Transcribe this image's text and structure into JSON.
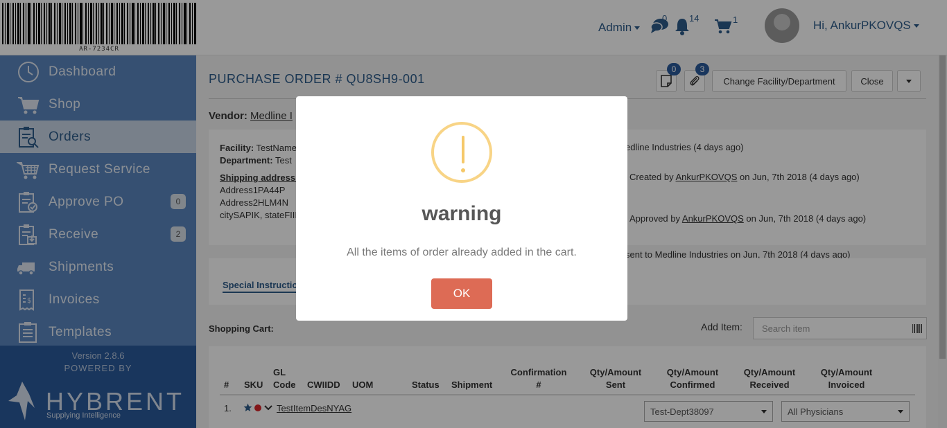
{
  "header": {
    "barcode_text": "AR-7234CR",
    "admin_label": "Admin",
    "messages_count": "0",
    "notifications_count": "14",
    "cart_count": "1",
    "greeting": "Hi, AnkurPKOVQS"
  },
  "sidebar": {
    "items": [
      {
        "label": "Dashboard",
        "icon": "clock-icon"
      },
      {
        "label": "Shop",
        "icon": "cart-icon"
      },
      {
        "label": "Orders",
        "icon": "orders-clipboard-icon"
      },
      {
        "label": "Request Service",
        "icon": "service-cart-icon"
      },
      {
        "label": "Approve PO",
        "icon": "approve-clipboard-icon",
        "badge": "0"
      },
      {
        "label": "Receive",
        "icon": "receive-clipboard-icon",
        "badge": "2"
      },
      {
        "label": "Shipments",
        "icon": "truck-icon"
      },
      {
        "label": "Invoices",
        "icon": "invoice-icon"
      },
      {
        "label": "Templates",
        "icon": "template-clipboard-icon"
      }
    ],
    "version": "Version 2.8.6",
    "powered_by": "POWERED BY",
    "logo_text": "HYBRENT",
    "logo_tagline": "Supplying Intelligence"
  },
  "main": {
    "title": "PURCHASE ORDER # QU8SH9-001",
    "notes_badge": "0",
    "attachments_badge": "3",
    "change_facility_label": "Change Facility/Department",
    "close_label": "Close",
    "vendor_label": "Vendor:",
    "vendor_name": "Medline I",
    "facility_label": "Facility:",
    "facility_value": "TestName",
    "department_label": "Department:",
    "department_value": "Test",
    "shipping_label": "Shipping address:",
    "address1": "Address1PA44P",
    "address2": "Address2HLM4N",
    "address3": "citySAPIK, stateFIII",
    "history": {
      "vendor_line": "edline Industries (4 days ago)",
      "created_prefix": "Created by",
      "created_user": "AnkurPKOVQS",
      "created_suffix": "on Jun, 7th 2018 (4 days ago)",
      "approved_prefix": "Approved by",
      "approved_user": "AnkurPKOVQS",
      "approved_suffix": "on Jun, 7th 2018 (4 days ago)",
      "sent_prefix": "sent to",
      "sent_vendor": "Medline Industries",
      "sent_suffix": "on Jun, 7th 2018 (4 days ago)"
    },
    "tab_label": "Special Instructio",
    "cart_label": "Shopping Cart:",
    "add_item_label": "Add Item:",
    "search_placeholder": "Search item",
    "table": {
      "headers": [
        "#",
        "SKU",
        "GL\nCode",
        "CWIIDD",
        "UOM",
        "Status",
        "Shipment",
        "Confirmation\n#",
        "Qty/Amount\nSent",
        "Qty/Amount\nConfirmed",
        "Qty/Amount\nReceived",
        "Qty/Amount\nInvoiced"
      ],
      "rows": [
        {
          "num": "1.",
          "item": "TestItemDesNYAG",
          "department": "Test-Dept38097",
          "physician": "All Physicians"
        }
      ]
    }
  },
  "modal": {
    "title": "warning",
    "message": "All the items of order already added in the cart.",
    "ok_label": "OK"
  },
  "colors": {
    "sidebar": "#5a86bf",
    "accent": "#2e5c8a",
    "ok_button": "#dd6b55",
    "warning": "#f8d486"
  }
}
